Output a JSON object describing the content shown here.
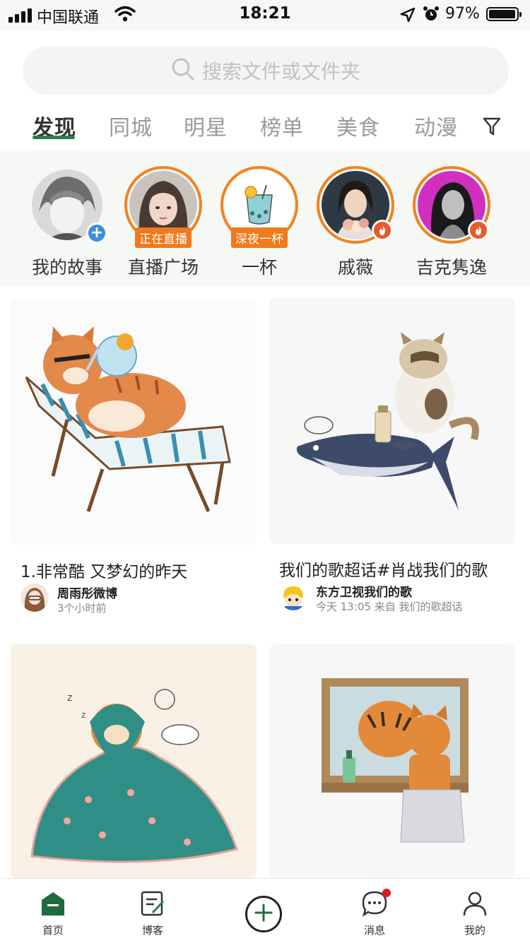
{
  "status_bar": {
    "carrier": "中国联通",
    "time": "18:21",
    "battery": "97%"
  },
  "search": {
    "placeholder": "搜索文件或文件夹"
  },
  "tabs": [
    {
      "label": "发现",
      "active": true
    },
    {
      "label": "同城"
    },
    {
      "label": "明星"
    },
    {
      "label": "榜单"
    },
    {
      "label": "美食"
    },
    {
      "label": "动漫"
    }
  ],
  "stories": [
    {
      "label": "我的故事",
      "badge": "plus"
    },
    {
      "label": "直播广场",
      "tag": "正在直播"
    },
    {
      "label": "一杯",
      "tag": "深夜一杯"
    },
    {
      "label": "戚薇",
      "badge": "fire"
    },
    {
      "label": "吉克隽逸",
      "badge": "fire"
    }
  ],
  "cards": [
    {
      "title": "1.非常酷 又梦幻的昨天",
      "author": "周雨彤微博",
      "meta": "3个小时前"
    },
    {
      "title": "我们的歌超话#肖战我们的歌",
      "author": "东方卫视我们的歌",
      "meta": "今天 13:05 来自 我们的歌超话"
    }
  ],
  "bottom_nav": [
    {
      "label": "首页",
      "icon": "home-icon"
    },
    {
      "label": "博客",
      "icon": "edit-icon"
    },
    {
      "label": "",
      "icon": "add-icon"
    },
    {
      "label": "消息",
      "icon": "message-icon"
    },
    {
      "label": "我的",
      "icon": "profile-icon"
    }
  ],
  "colors": {
    "accent_green": "#2e7d4f",
    "live_orange": "#f0841e",
    "notification_red": "#e01b1b"
  }
}
